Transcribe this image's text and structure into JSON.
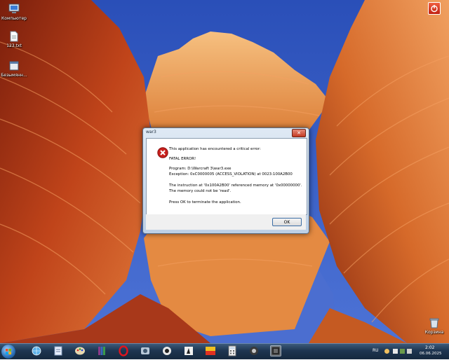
{
  "desktop": {
    "icons": [
      {
        "label": "Компьютер",
        "icon": "computer-icon"
      },
      {
        "label": "123.txt",
        "icon": "text-file-icon"
      },
      {
        "label": "Безымянн...",
        "icon": "untitled-file-icon"
      },
      {
        "label": "Корзина",
        "icon": "recycle-bin-icon"
      }
    ]
  },
  "dialog": {
    "title": "war3",
    "close_symbol": "✕",
    "lines": [
      "This application has encountered a critical error:",
      "FATAL ERROR!",
      "Program:  D:\\Warcraft 3\\war3.exe",
      "Exception: 0xC0000005 (ACCESS_VIOLATION) at 0023:100A2B00",
      "The instruction at '0x100A2B00' referenced memory at '0x00000000'.",
      "The memory could not be 'read'.",
      "Press OK to terminate the application."
    ],
    "ok_label": "OK"
  },
  "taskbar": {
    "apps": [
      "start-orb",
      "app-1",
      "notepad",
      "paint",
      "winrar",
      "opera",
      "app-6",
      "app-7",
      "counter-strike",
      "app-9",
      "calculator",
      "app-11",
      "war3"
    ],
    "tray": {
      "language": "RU",
      "time": "2:02",
      "date": "06.06.2025"
    }
  },
  "colors": {
    "error_red": "#c8201c",
    "taskbar": "#1e3550",
    "dialog_frame": "#bdd0e6"
  }
}
